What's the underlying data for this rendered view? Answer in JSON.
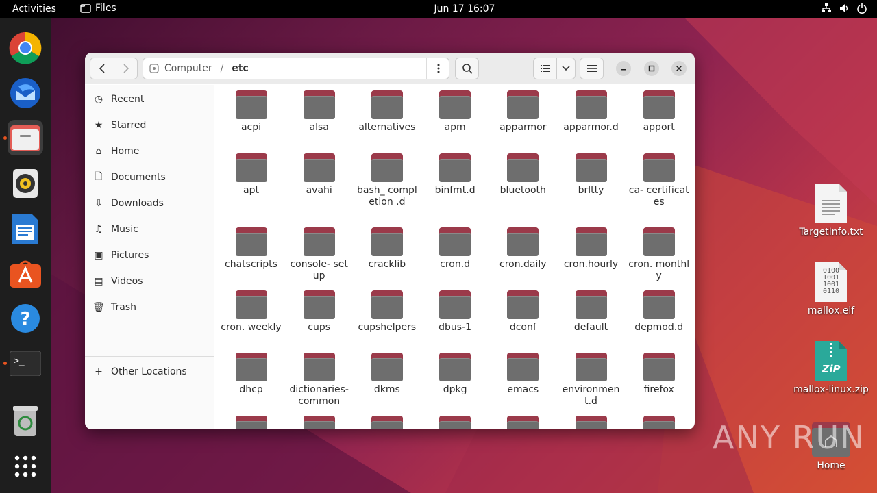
{
  "topbar": {
    "activities": "Activities",
    "app_name": "Files",
    "clock": "Jun 17  16:07"
  },
  "dock": {
    "apps": [
      "chrome-icon",
      "thunderbird-icon",
      "files-icon",
      "rhythmbox-icon",
      "writer-icon",
      "appcenter-icon",
      "help-icon",
      "terminal-icon",
      "trash-icon",
      "app-grid-icon"
    ]
  },
  "window": {
    "path": [
      "Computer",
      "etc"
    ],
    "sidebar": [
      {
        "label": "Recent",
        "icon": "clock-icon"
      },
      {
        "label": "Starred",
        "icon": "star-icon"
      },
      {
        "label": "Home",
        "icon": "home-icon"
      },
      {
        "label": "Documents",
        "icon": "documents-icon"
      },
      {
        "label": "Downloads",
        "icon": "download-icon"
      },
      {
        "label": "Music",
        "icon": "music-icon"
      },
      {
        "label": "Pictures",
        "icon": "pictures-icon"
      },
      {
        "label": "Videos",
        "icon": "videos-icon"
      },
      {
        "label": "Trash",
        "icon": "trash-icon"
      }
    ],
    "other_locations": "Other Locations",
    "folders": [
      "acpi",
      "alsa",
      "alternatives",
      "apm",
      "apparmor",
      "apparmor.d",
      "apport",
      "apt",
      "avahi",
      "bash_ completion .d",
      "binfmt.d",
      "bluetooth",
      "brltty",
      "ca- certificates",
      "chatscripts",
      "console- setup",
      "cracklib",
      "cron.d",
      "cron.daily",
      "cron.hourly",
      "cron. monthly",
      "cron. weekly",
      "cups",
      "cupshelpers",
      "dbus-1",
      "dconf",
      "default",
      "depmod.d",
      "dhcp",
      "dictionaries-common",
      "dkms",
      "dpkg",
      "emacs",
      "environment.d",
      "firefox",
      "",
      "",
      "",
      "",
      "",
      "",
      ""
    ]
  },
  "desktop": {
    "icons": [
      {
        "label": "TargetInfo.txt"
      },
      {
        "label": "mallox.elf"
      },
      {
        "label": "mallox-linux.zip"
      },
      {
        "label": "Home"
      }
    ],
    "elf_glyph": "0100\n1001\n1001\n0110",
    "zip_glyph": "ZiP"
  },
  "watermark": "ANY RUN"
}
